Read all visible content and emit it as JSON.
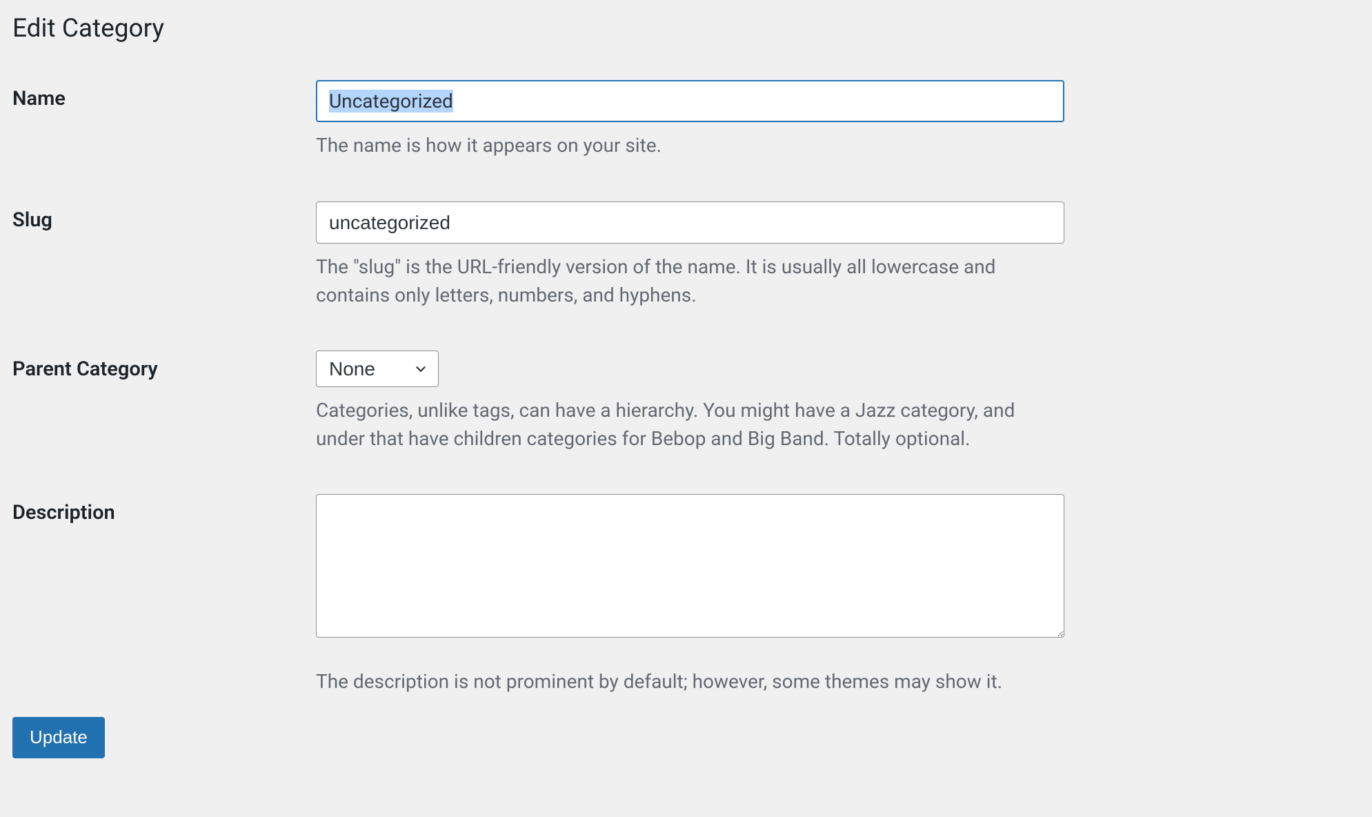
{
  "page": {
    "title": "Edit Category"
  },
  "fields": {
    "name": {
      "label": "Name",
      "value": "Uncategorized",
      "help": "The name is how it appears on your site."
    },
    "slug": {
      "label": "Slug",
      "value": "uncategorized",
      "help": "The \"slug\" is the URL-friendly version of the name. It is usually all lowercase and contains only letters, numbers, and hyphens."
    },
    "parent": {
      "label": "Parent Category",
      "selected": "None",
      "help": "Categories, unlike tags, can have a hierarchy. You might have a Jazz category, and under that have children categories for Bebop and Big Band. Totally optional."
    },
    "description": {
      "label": "Description",
      "value": "",
      "help": "The description is not prominent by default; however, some themes may show it."
    }
  },
  "actions": {
    "update_label": "Update"
  }
}
